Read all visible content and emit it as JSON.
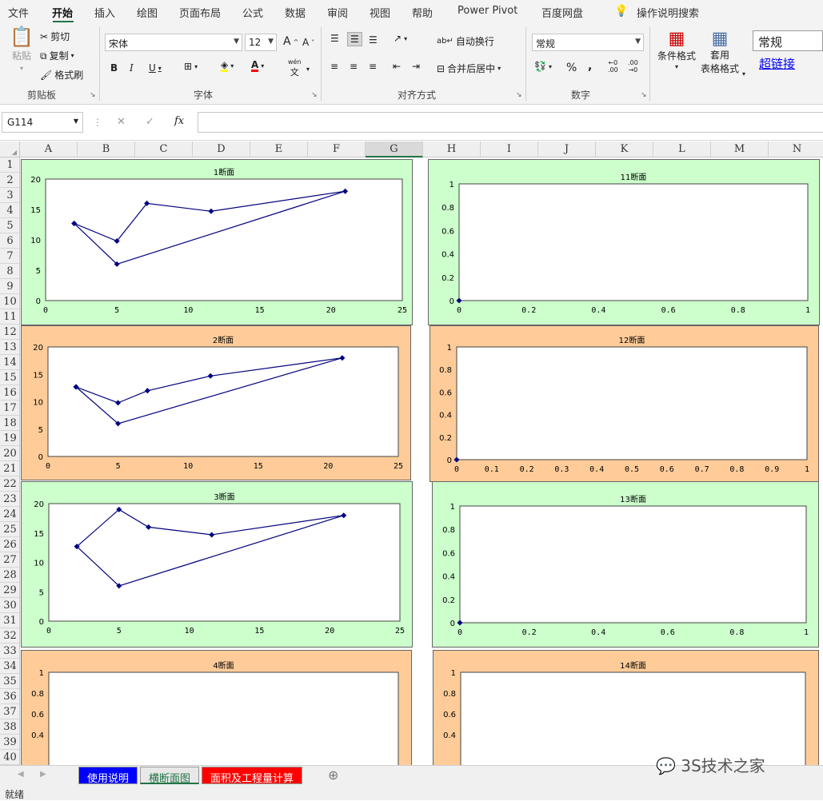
{
  "menu": [
    "文件",
    "开始",
    "插入",
    "绘图",
    "页面布局",
    "公式",
    "数据",
    "审阅",
    "视图",
    "帮助",
    "Power Pivot",
    "百度网盘"
  ],
  "tell_me": "操作说明搜索",
  "ribbon": {
    "paste": "粘贴",
    "cut": "剪切",
    "copy": "复制",
    "format_painter": "格式刷",
    "clipboard_label": "剪贴板",
    "font_name": "宋体",
    "font_size": "12",
    "grow_font": "A",
    "shrink_font": "A",
    "bold": "B",
    "italic": "I",
    "underline": "U",
    "phonetic_top": "wén",
    "phonetic_bottom": "文",
    "font_label": "字体",
    "wrap_text": "自动换行",
    "merge_center": "合并后居中",
    "align_label": "对齐方式",
    "number_format": "常规",
    "percent": "%",
    "comma": ",",
    "inc_decimal_top": "←0",
    "inc_decimal_bottom": ".00",
    "dec_decimal_top": ".00",
    "dec_decimal_bottom": "→0",
    "number_label": "数字",
    "cond_format": "条件格式",
    "table_format_1": "套用",
    "table_format_2": "表格格式",
    "style_normal": "常规",
    "style_hyperlink": "超链接"
  },
  "formula_bar": {
    "name_box": "G114",
    "fx": "fx",
    "cancel": "✕",
    "enter": "✓",
    "value": ""
  },
  "columns": [
    "A",
    "B",
    "C",
    "D",
    "E",
    "F",
    "G",
    "H",
    "I",
    "J",
    "K",
    "L",
    "M",
    "N"
  ],
  "rows": [
    "1",
    "2",
    "3",
    "4",
    "5",
    "6",
    "7",
    "8",
    "9",
    "10",
    "11",
    "12",
    "13",
    "14",
    "15",
    "16",
    "17",
    "18",
    "19",
    "20",
    "21",
    "22",
    "23",
    "24",
    "25",
    "26",
    "27",
    "28",
    "29",
    "30",
    "31",
    "32",
    "33",
    "34",
    "35",
    "36",
    "37",
    "38",
    "39",
    "40"
  ],
  "colors": {
    "green_panel": "#ccffcc",
    "orange_panel": "#ffcc99",
    "series": "#000080",
    "accent": "#217346"
  },
  "chart_data": [
    {
      "type": "scatter",
      "title": "1断面",
      "xlim": [
        0,
        25
      ],
      "ylim": [
        0,
        20
      ],
      "xticks": [
        "0",
        "5",
        "10",
        "15",
        "20",
        "25"
      ],
      "yticks": [
        "0",
        "5",
        "10",
        "15",
        "20"
      ],
      "x": [
        2,
        5,
        7.1,
        11.6,
        21,
        5,
        2
      ],
      "y": [
        12.7,
        9.8,
        16,
        14.7,
        18,
        6,
        12.7
      ]
    },
    {
      "type": "scatter",
      "title": "11断面",
      "xlim": [
        0,
        1
      ],
      "ylim": [
        0,
        1
      ],
      "xticks": [
        "0",
        "0.2",
        "0.4",
        "0.6",
        "0.8",
        "1"
      ],
      "yticks": [
        "0",
        "0.2",
        "0.4",
        "0.6",
        "0.8",
        "1"
      ],
      "x": [
        0
      ],
      "y": [
        0
      ]
    },
    {
      "type": "scatter",
      "title": "2断面",
      "xlim": [
        0,
        25
      ],
      "ylim": [
        0,
        20
      ],
      "xticks": [
        "0",
        "5",
        "10",
        "15",
        "20",
        "25"
      ],
      "yticks": [
        "0",
        "5",
        "10",
        "15",
        "20"
      ],
      "x": [
        2,
        5,
        7.1,
        11.6,
        21,
        5,
        2
      ],
      "y": [
        12.7,
        9.8,
        12,
        14.7,
        18,
        6,
        12.7
      ]
    },
    {
      "type": "scatter",
      "title": "12断面",
      "xlim": [
        0,
        1
      ],
      "ylim": [
        0,
        1
      ],
      "xticks": [
        "0",
        "0.1",
        "0.2",
        "0.3",
        "0.4",
        "0.5",
        "0.6",
        "0.7",
        "0.8",
        "0.9",
        "1"
      ],
      "yticks": [
        "0",
        "0.2",
        "0.4",
        "0.6",
        "0.8",
        "1"
      ],
      "x": [
        0
      ],
      "y": [
        0
      ]
    },
    {
      "type": "scatter",
      "title": "3断面",
      "xlim": [
        0,
        25
      ],
      "ylim": [
        0,
        20
      ],
      "xticks": [
        "0",
        "5",
        "10",
        "15",
        "20",
        "25"
      ],
      "yticks": [
        "0",
        "5",
        "10",
        "15",
        "20"
      ],
      "x": [
        2,
        5,
        7.1,
        11.6,
        21,
        5,
        2
      ],
      "y": [
        12.7,
        19,
        16,
        14.7,
        18,
        6,
        12.7
      ]
    },
    {
      "type": "scatter",
      "title": "13断面",
      "xlim": [
        0,
        1
      ],
      "ylim": [
        0,
        1
      ],
      "xticks": [
        "0",
        "0.2",
        "0.4",
        "0.6",
        "0.8",
        "1"
      ],
      "yticks": [
        "0",
        "0.2",
        "0.4",
        "0.6",
        "0.8",
        "1"
      ],
      "x": [
        0
      ],
      "y": [
        0
      ]
    },
    {
      "type": "scatter",
      "title": "4断面",
      "xlim": [
        0,
        1
      ],
      "ylim": [
        0,
        1
      ],
      "xticks": [],
      "yticks": [
        "0.4",
        "0.6",
        "0.8",
        "1"
      ],
      "x": [],
      "y": []
    },
    {
      "type": "scatter",
      "title": "14断面",
      "xlim": [
        0,
        1
      ],
      "ylim": [
        0,
        1
      ],
      "xticks": [],
      "yticks": [
        "0.4",
        "0.6",
        "0.8",
        "1"
      ],
      "x": [],
      "y": []
    }
  ],
  "sheet_tabs": [
    "使用说明",
    "横断面图",
    "面积及工程量计算"
  ],
  "status": "就绪",
  "watermark": "3S技术之家"
}
